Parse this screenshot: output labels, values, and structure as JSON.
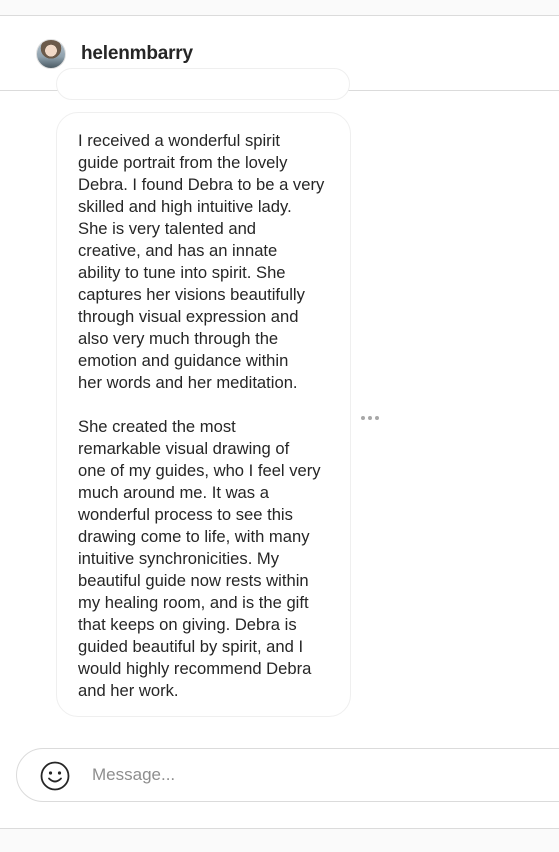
{
  "header": {
    "username": "helenmbarry",
    "avatar_icon": "user-avatar"
  },
  "message": {
    "paragraphs": [
      "I received a wonderful spirit\nguide portrait from the lovely\nDebra. I found Debra to be a very\nskilled and high intuitive lady.\nShe is very talented and\ncreative, and has an innate\nability to tune into spirit. She\ncaptures her visions beautifully\nthrough visual expression and\nalso very much through the\nemotion and guidance within\nher words and her meditation.",
      "She created the most\nremarkable visual drawing of\none of my guides, who I feel very\nmuch around me. It was a\nwonderful process to see this\ndrawing come to life, with many\nintuitive synchronicities. My\nbeautiful guide now rests within\nmy healing room, and is the gift\nthat keeps on giving. Debra is\nguided beautiful by spirit, and I\nwould highly recommend Debra\nand her work."
    ],
    "more_icon": "more-options-icon"
  },
  "composer": {
    "placeholder": "Message...",
    "value": "",
    "emoji_icon": "emoji-icon"
  },
  "colors": {
    "text": "#262626",
    "border": "#dbdbdb",
    "bubble_border": "#efefef",
    "placeholder": "#8e8e8e",
    "page_bg": "#fafafa"
  }
}
